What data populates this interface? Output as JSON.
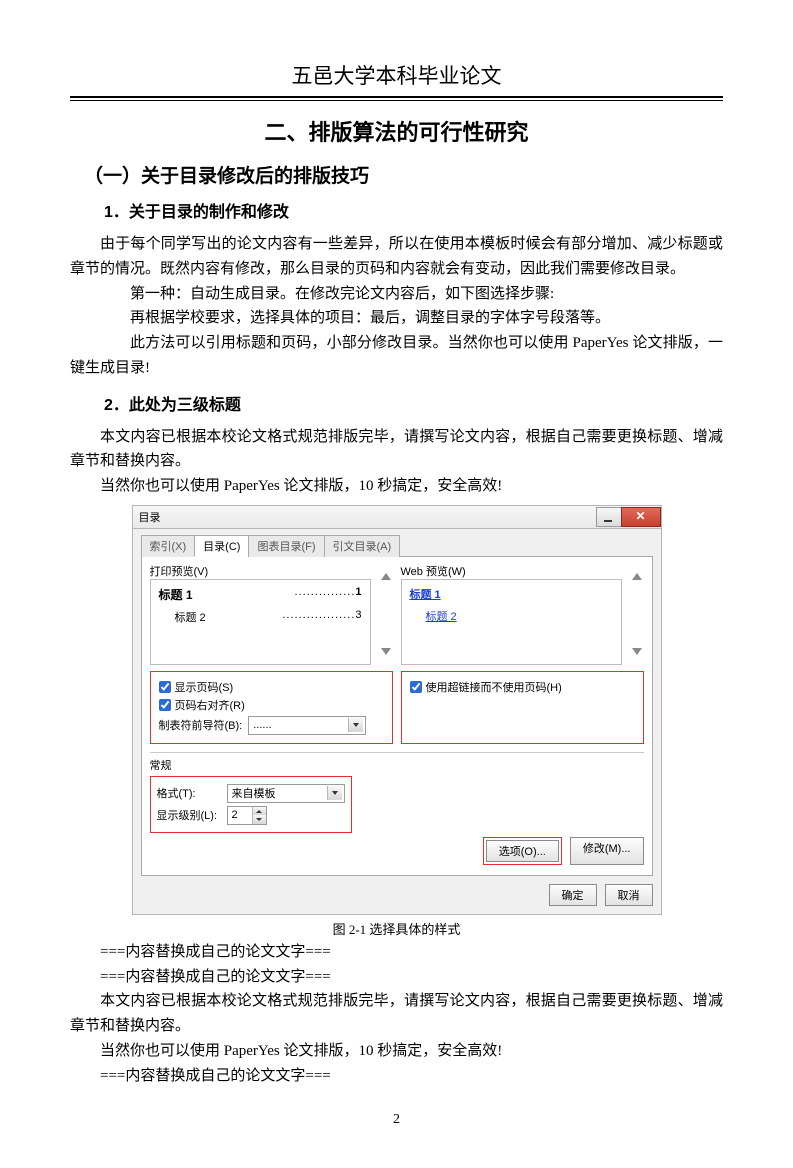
{
  "header": {
    "university": "五邑大学本科毕业论文"
  },
  "headings": {
    "h1": "二、排版算法的可行性研究",
    "h2": "（一）关于目录修改后的排版技巧",
    "h3a": "1．关于目录的制作和修改",
    "h3b": "2．此处为三级标题"
  },
  "paragraphs": {
    "p1": "由于每个同学写出的论文内容有一些差异，所以在使用本模板时候会有部分增加、减少标题或章节的情况。既然内容有修改，那么目录的页码和内容就会有变动，因此我们需要修改目录。",
    "p2": "第一种：自动生成目录。在修改完论文内容后，如下图选择步骤:",
    "p3": "再根据学校要求，选择具体的项目：最后，调整目录的字体字号段落等。",
    "p4": "此方法可以引用标题和页码，小部分修改目录。当然你也可以使用 PaperYes 论文排版，一键生成目录!",
    "p5": "本文内容已根据本校论文格式规范排版完毕，请撰写论文内容，根据自己需要更换标题、增减章节和替换内容。",
    "p6": "当然你也可以使用 PaperYes 论文排版，10 秒搞定，安全高效!",
    "p7": "===内容替换成自己的论文文字===",
    "p8": "===内容替换成自己的论文文字===",
    "p9": "本文内容已根据本校论文格式规范排版完毕，请撰写论文内容，根据自己需要更换标题、增减章节和替换内容。",
    "p10": "当然你也可以使用 PaperYes 论文排版，10 秒搞定，安全高效!",
    "p11": "===内容替换成自己的论文文字==="
  },
  "figure": {
    "caption": "图 2-1  选择具体的样式"
  },
  "dialog": {
    "title": "目录",
    "tabs": [
      "索引(X)",
      "目录(C)",
      "图表目录(F)",
      "引文目录(A)"
    ],
    "activeTab": 1,
    "preview_label": "打印预览(V)",
    "web_label": "Web 预览(W)",
    "preview_h1": "标题 1",
    "preview_h1_page": "1",
    "preview_h2": "标题 2",
    "preview_h2_page": "3",
    "web_h1": "标题 1",
    "web_h2": "标题 2",
    "cb_show_page": "显示页码(S)",
    "cb_align_right": "页码右对齐(R)",
    "cb_hyperlink": "使用超链接而不使用页码(H)",
    "tab_leader_label": "制表符前导符(B):",
    "tab_leader_value": "......",
    "general_label": "常规",
    "format_label": "格式(T):",
    "format_value": "来自模板",
    "levels_label": "显示级别(L):",
    "levels_value": "2",
    "btn_options": "选项(O)...",
    "btn_modify": "修改(M)...",
    "btn_ok": "确定",
    "btn_cancel": "取消"
  },
  "page_number": "2"
}
